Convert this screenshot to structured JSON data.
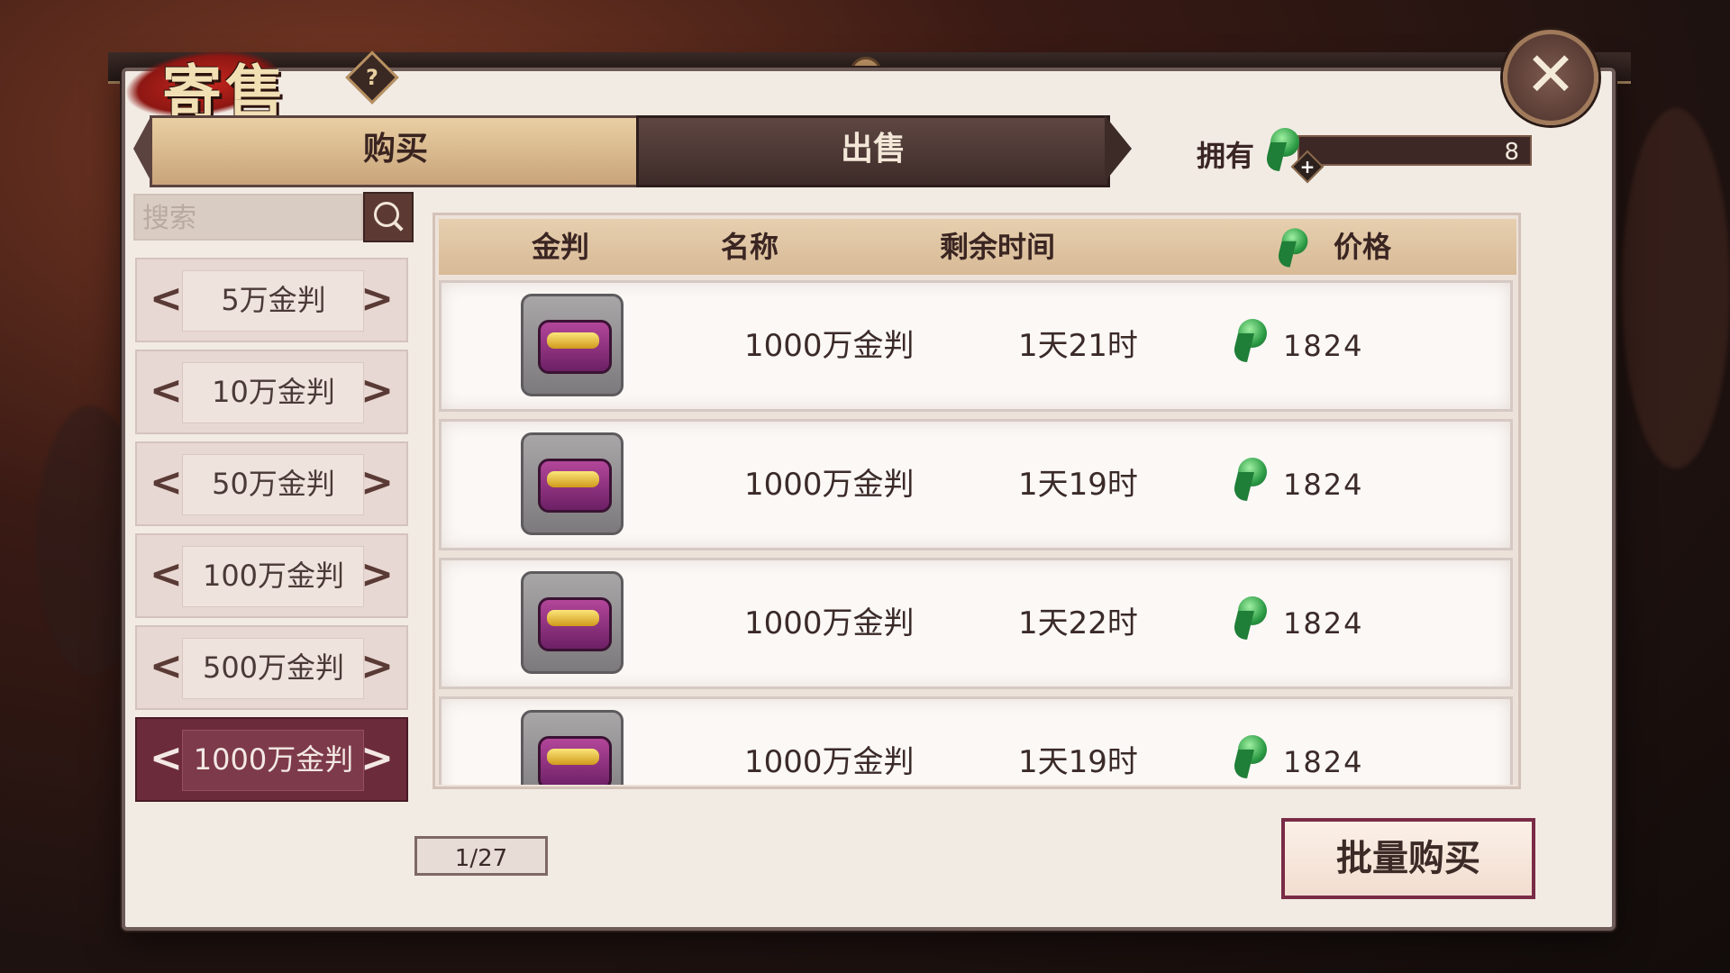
{
  "title": "寄售",
  "help_icon": "?",
  "close_icon": "✕",
  "tabs": [
    {
      "label": "购买",
      "active": true
    },
    {
      "label": "出售",
      "active": false
    }
  ],
  "owned": {
    "label": "拥有",
    "value": "8",
    "icon": "magatama-icon"
  },
  "search": {
    "placeholder": "搜索"
  },
  "categories": [
    {
      "label": "5万金判",
      "selected": false
    },
    {
      "label": "10万金判",
      "selected": false
    },
    {
      "label": "50万金判",
      "selected": false
    },
    {
      "label": "100万金判",
      "selected": false
    },
    {
      "label": "500万金判",
      "selected": false
    },
    {
      "label": "1000万金判",
      "selected": true
    }
  ],
  "table": {
    "headers": [
      "金判",
      "名称",
      "剩余时间",
      "价格"
    ],
    "rows": [
      {
        "name": "1000万金判",
        "time": "1天21时",
        "price": "1824"
      },
      {
        "name": "1000万金判",
        "time": "1天19时",
        "price": "1824"
      },
      {
        "name": "1000万金判",
        "time": "1天22时",
        "price": "1824"
      },
      {
        "name": "1000万金判",
        "time": "1天19时",
        "price": "1824"
      }
    ]
  },
  "pagination": "1/27",
  "bulk_buy_label": "批量购买",
  "colors": {
    "accent": "#6c2b3b",
    "tab_active": "#e9cfa3",
    "tab_inactive": "#3d2b28"
  }
}
